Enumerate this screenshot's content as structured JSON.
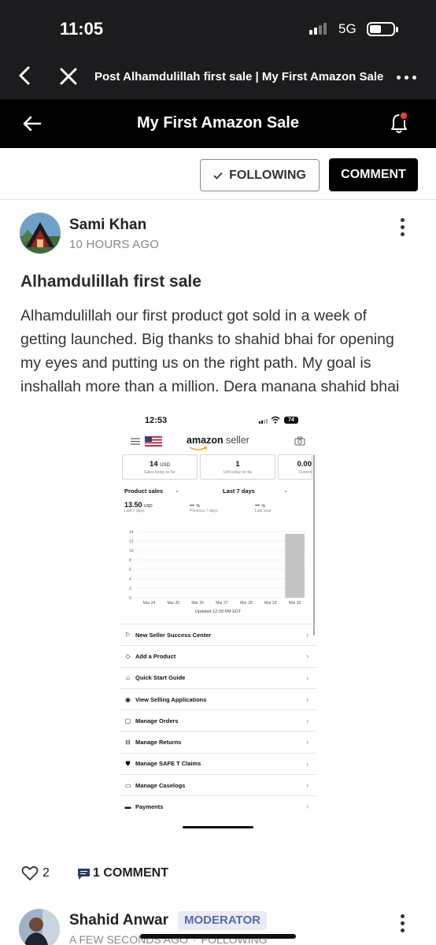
{
  "status": {
    "time": "11:05",
    "network": "5G"
  },
  "browser": {
    "title": "Post Alhamdulillah first sale | My First Amazon Sale"
  },
  "app": {
    "title": "My First Amazon Sale"
  },
  "actions": {
    "following_label": "FOLLOWING",
    "comment_label": "COMMENT"
  },
  "post": {
    "author": "Sami Khan",
    "time": "10 HOURS AGO",
    "title": "Alhamdulillah first sale",
    "body": "Alhamdulillah our first product got sold in a week of getting launched. Big thanks to shahid bhai for opening my eyes and putting us on the right path. My goal is inshallah more than a million. Dera manana shahid bhai",
    "likes": "2",
    "comments": "1 COMMENT"
  },
  "embedded": {
    "time": "12:53",
    "battery": "74",
    "logo_bold": "amazon",
    "logo_rest": " seller",
    "tiles": [
      {
        "value": "14",
        "unit": "USD",
        "label": "Sales today so far"
      },
      {
        "value": "1",
        "unit": "",
        "label": "Unit today so far"
      },
      {
        "value": "0.00",
        "unit": "",
        "label": "Current"
      }
    ],
    "dropdown1": "Product sales",
    "dropdown2": "Last 7 days",
    "metrics": [
      {
        "value": "13.50",
        "unit": "USD",
        "label": "Last 7 days"
      },
      {
        "value": "--",
        "unit": "%",
        "label": "Previous 7 days"
      },
      {
        "value": "--",
        "unit": "%",
        "label": "Last year"
      }
    ],
    "updated": "Updated 12:39 PM EDT",
    "menu": [
      {
        "icon": "graduation-icon",
        "label": "New Seller Success Center"
      },
      {
        "icon": "tag-icon",
        "label": "Add a Product"
      },
      {
        "icon": "mortarboard-icon",
        "label": "Quick Start Guide"
      },
      {
        "icon": "eye-icon",
        "label": "View Selling Applications"
      },
      {
        "icon": "orders-icon",
        "label": "Manage Orders"
      },
      {
        "icon": "returns-icon",
        "label": "Manage Returns"
      },
      {
        "icon": "shield-icon",
        "label": "Manage SAFE T Claims"
      },
      {
        "icon": "chat-icon",
        "label": "Manage Caselogs"
      },
      {
        "icon": "card-icon",
        "label": "Payments"
      }
    ]
  },
  "chart_data": {
    "type": "bar",
    "categories": [
      "Mar 24",
      "Mar 25",
      "Mar 26",
      "Mar 27",
      "Mar 28",
      "Mar 29",
      "Mar 30"
    ],
    "values": [
      0,
      0,
      0,
      0,
      0,
      0,
      13.5
    ],
    "yticks": [
      0,
      2,
      4,
      6,
      8,
      10,
      12,
      14
    ],
    "ylim": [
      0,
      14
    ],
    "grid": true,
    "bar_color": "#c4c4c4"
  },
  "comment": {
    "author": "Shahid Anwar",
    "badge": "MODERATOR",
    "time": "A FEW SECONDS AGO",
    "following": "FOLLOWING"
  }
}
